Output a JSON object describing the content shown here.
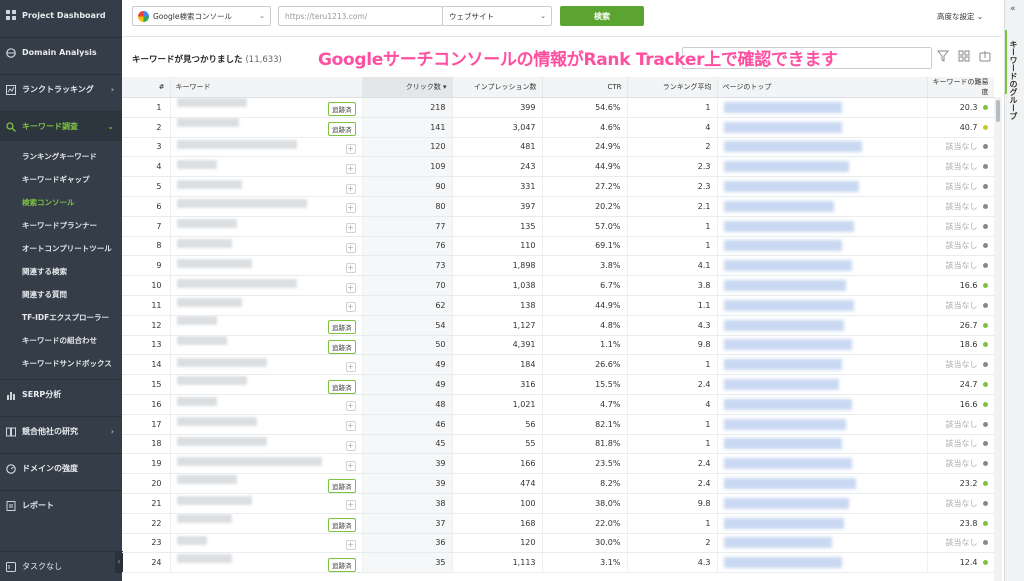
{
  "sidebar": {
    "items": [
      {
        "label": "Project Dashboard",
        "icon": "grid-icon"
      },
      {
        "label": "Domain Analysis",
        "icon": "globe-icon"
      },
      {
        "label": "ランクトラッキング",
        "icon": "chart-icon"
      },
      {
        "label": "キーワード調査",
        "icon": "magnifier-icon"
      },
      {
        "label": "SERP分析",
        "icon": "bar-chart-icon"
      },
      {
        "label": "競合他社の研究",
        "icon": "compare-icon"
      },
      {
        "label": "ドメインの強度",
        "icon": "gauge-icon"
      },
      {
        "label": "レポート",
        "icon": "report-icon"
      }
    ],
    "subitems": [
      "ランキングキーワード",
      "キーワードギャップ",
      "検索コンソール",
      "キーワードプランナー",
      "オートコンプリートツール",
      "関連する検索",
      "関連する質問",
      "TF-IDFエクスプローラー",
      "キーワードの組合わせ",
      "キーワードサンドボックス"
    ],
    "active_sub": "検索コンソール",
    "task": "タスクなし"
  },
  "topbar": {
    "source_select": "Google検索コンソール",
    "url_value": "https://teru1213.com/",
    "scope_select": "ウェブサイト",
    "search_button": "検索",
    "advanced": "高度な設定"
  },
  "header": {
    "found_label": "キーワードが見つかりました",
    "found_count": "(11,633)",
    "banner": "Googleサーチコンソールの情報がRank Tracker上で確認できます"
  },
  "right_panel": {
    "label": "キーワードのグループ"
  },
  "colors": {
    "accent": "#7dc243",
    "banner": "#ff4fa1",
    "sidebar": "#343d48"
  },
  "table": {
    "headers": {
      "idx": "#",
      "keyword": "キーワード",
      "clicks": "クリック数",
      "impressions": "インプレッション数",
      "ctr": "CTR",
      "rank": "ランキング平均",
      "top_page": "ページのトップ",
      "difficulty": "キーワードの難易度"
    },
    "tracked_label": "追跡済",
    "na_label": "該当なし",
    "rows": [
      {
        "i": "1",
        "tracked": true,
        "clicks": "218",
        "imp": "399",
        "ctr": "54.6%",
        "rank": "1",
        "diff": "20.3",
        "dot": "#7dc243"
      },
      {
        "i": "2",
        "tracked": true,
        "clicks": "141",
        "imp": "3,047",
        "ctr": "4.6%",
        "rank": "4",
        "diff": "40.7",
        "dot": "#c8c82a"
      },
      {
        "i": "3",
        "tracked": false,
        "clicks": "120",
        "imp": "481",
        "ctr": "24.9%",
        "rank": "2",
        "diff": "",
        "dot": "#888"
      },
      {
        "i": "4",
        "tracked": false,
        "clicks": "109",
        "imp": "243",
        "ctr": "44.9%",
        "rank": "2.3",
        "diff": "",
        "dot": "#888"
      },
      {
        "i": "5",
        "tracked": false,
        "clicks": "90",
        "imp": "331",
        "ctr": "27.2%",
        "rank": "2.3",
        "diff": "",
        "dot": "#888"
      },
      {
        "i": "6",
        "tracked": false,
        "clicks": "80",
        "imp": "397",
        "ctr": "20.2%",
        "rank": "2.1",
        "diff": "",
        "dot": "#888"
      },
      {
        "i": "7",
        "tracked": false,
        "clicks": "77",
        "imp": "135",
        "ctr": "57.0%",
        "rank": "1",
        "diff": "",
        "dot": "#888"
      },
      {
        "i": "8",
        "tracked": false,
        "clicks": "76",
        "imp": "110",
        "ctr": "69.1%",
        "rank": "1",
        "diff": "",
        "dot": "#888"
      },
      {
        "i": "9",
        "tracked": false,
        "clicks": "73",
        "imp": "1,898",
        "ctr": "3.8%",
        "rank": "4.1",
        "diff": "",
        "dot": "#888"
      },
      {
        "i": "10",
        "tracked": false,
        "clicks": "70",
        "imp": "1,038",
        "ctr": "6.7%",
        "rank": "3.8",
        "diff": "16.6",
        "dot": "#7dc243"
      },
      {
        "i": "11",
        "tracked": false,
        "clicks": "62",
        "imp": "138",
        "ctr": "44.9%",
        "rank": "1.1",
        "diff": "",
        "dot": "#888"
      },
      {
        "i": "12",
        "tracked": true,
        "clicks": "54",
        "imp": "1,127",
        "ctr": "4.8%",
        "rank": "4.3",
        "diff": "26.7",
        "dot": "#7dc243"
      },
      {
        "i": "13",
        "tracked": true,
        "clicks": "50",
        "imp": "4,391",
        "ctr": "1.1%",
        "rank": "9.8",
        "diff": "18.6",
        "dot": "#7dc243"
      },
      {
        "i": "14",
        "tracked": false,
        "clicks": "49",
        "imp": "184",
        "ctr": "26.6%",
        "rank": "1",
        "diff": "",
        "dot": "#888"
      },
      {
        "i": "15",
        "tracked": true,
        "clicks": "49",
        "imp": "316",
        "ctr": "15.5%",
        "rank": "2.4",
        "diff": "24.7",
        "dot": "#7dc243"
      },
      {
        "i": "16",
        "tracked": false,
        "clicks": "48",
        "imp": "1,021",
        "ctr": "4.7%",
        "rank": "4",
        "diff": "16.6",
        "dot": "#7dc243"
      },
      {
        "i": "17",
        "tracked": false,
        "clicks": "46",
        "imp": "56",
        "ctr": "82.1%",
        "rank": "1",
        "diff": "",
        "dot": "#888"
      },
      {
        "i": "18",
        "tracked": false,
        "clicks": "45",
        "imp": "55",
        "ctr": "81.8%",
        "rank": "1",
        "diff": "",
        "dot": "#888"
      },
      {
        "i": "19",
        "tracked": false,
        "clicks": "39",
        "imp": "166",
        "ctr": "23.5%",
        "rank": "2.4",
        "diff": "",
        "dot": "#888"
      },
      {
        "i": "20",
        "tracked": true,
        "clicks": "39",
        "imp": "474",
        "ctr": "8.2%",
        "rank": "2.4",
        "diff": "23.2",
        "dot": "#7dc243"
      },
      {
        "i": "21",
        "tracked": false,
        "clicks": "38",
        "imp": "100",
        "ctr": "38.0%",
        "rank": "9.8",
        "diff": "",
        "dot": "#888"
      },
      {
        "i": "22",
        "tracked": true,
        "clicks": "37",
        "imp": "168",
        "ctr": "22.0%",
        "rank": "1",
        "diff": "23.8",
        "dot": "#7dc243"
      },
      {
        "i": "23",
        "tracked": false,
        "clicks": "36",
        "imp": "120",
        "ctr": "30.0%",
        "rank": "2",
        "diff": "",
        "dot": "#888"
      },
      {
        "i": "24",
        "tracked": true,
        "clicks": "35",
        "imp": "1,113",
        "ctr": "3.1%",
        "rank": "4.3",
        "diff": "12.4",
        "dot": "#7dc243"
      }
    ]
  }
}
